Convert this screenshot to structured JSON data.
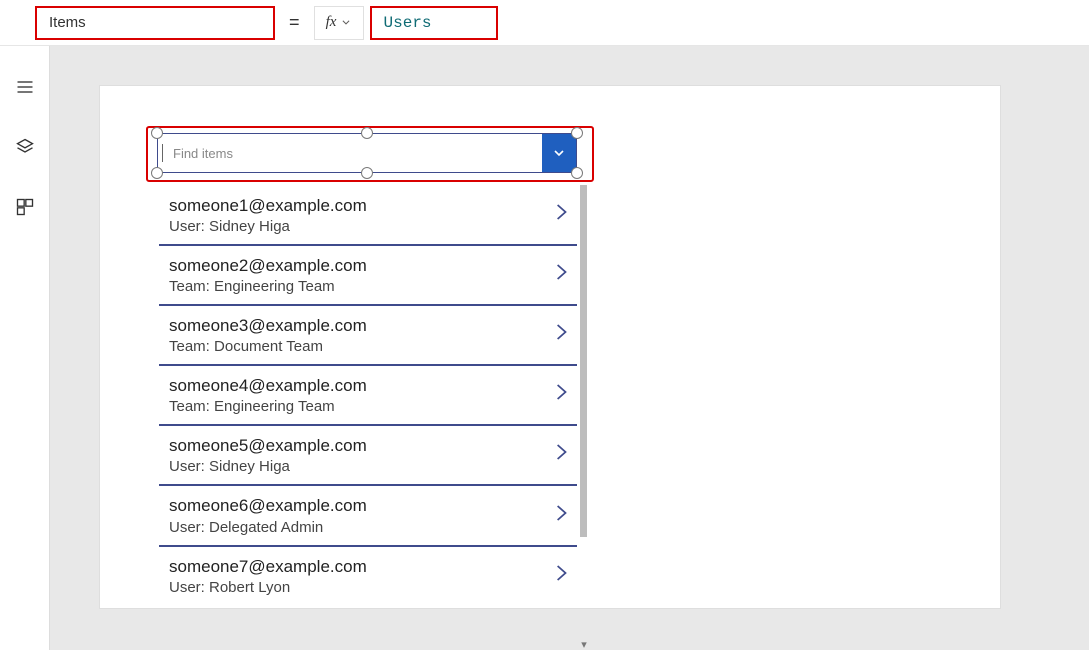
{
  "formulaBar": {
    "propertyName": "Items",
    "fxLabel": "fx",
    "equals": "=",
    "formula": "Users"
  },
  "combobox": {
    "placeholder": "Find items"
  },
  "listItems": [
    {
      "title": "someone1@example.com",
      "subtitle": "User: Sidney Higa"
    },
    {
      "title": "someone2@example.com",
      "subtitle": "Team: Engineering Team"
    },
    {
      "title": "someone3@example.com",
      "subtitle": "Team: Document Team"
    },
    {
      "title": "someone4@example.com",
      "subtitle": "Team: Engineering Team"
    },
    {
      "title": "someone5@example.com",
      "subtitle": "User: Sidney Higa"
    },
    {
      "title": "someone6@example.com",
      "subtitle": "User: Delegated Admin"
    },
    {
      "title": "someone7@example.com",
      "subtitle": "User: Robert Lyon"
    }
  ]
}
